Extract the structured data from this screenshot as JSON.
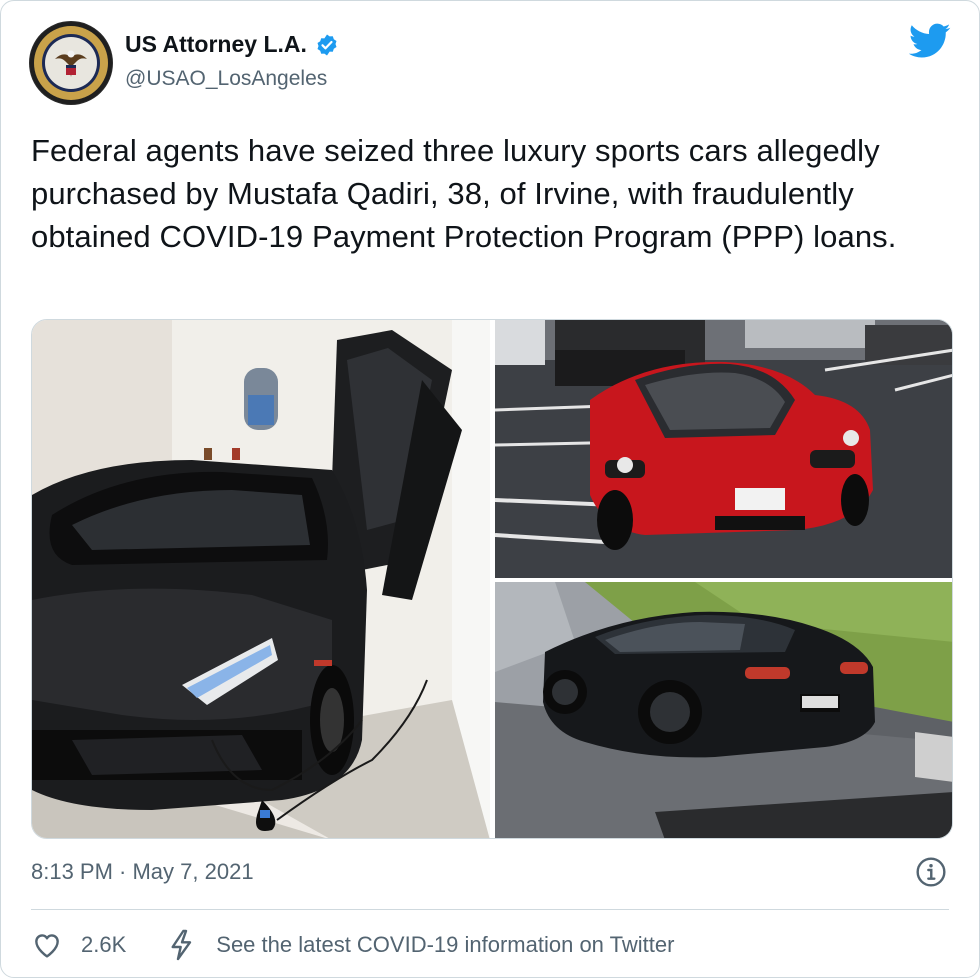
{
  "author": {
    "display_name": "US Attorney L.A.",
    "handle": "@USAO_LosAngeles",
    "avatar_icon": "doj-seal-icon",
    "verified_icon": "verified-badge-icon"
  },
  "tweet": {
    "text": "Federal agents have seized three luxury sports cars allegedly purchased by Mustafa Qadiri, 38, of Irvine, with fraudulently obtained COVID-19 Payment Protection Program (PPP) loans."
  },
  "media": {
    "photos": [
      {
        "subject": "black-lamborghini-photo"
      },
      {
        "subject": "red-ferrari-photo"
      },
      {
        "subject": "black-bentley-photo"
      }
    ]
  },
  "meta": {
    "timestamp": "8:13 PM · May 7, 2021"
  },
  "actions": {
    "like_count": "2.6K",
    "covid_link_text": "See the latest COVID-19 information on Twitter"
  },
  "colors": {
    "twitter_blue": "#1d9bf0",
    "secondary_text": "#536471",
    "border": "#cfd9de"
  }
}
